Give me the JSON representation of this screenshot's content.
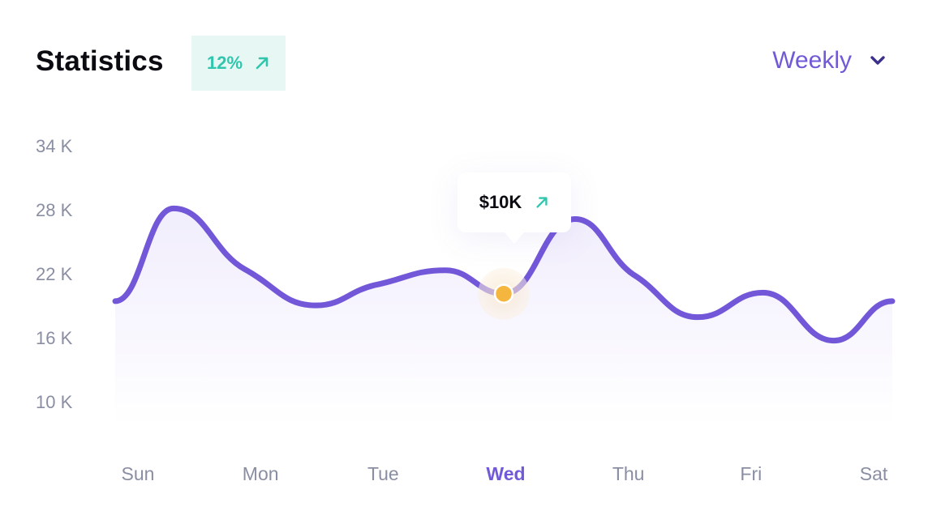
{
  "header": {
    "title": "Statistics",
    "change_badge": {
      "value": "12%",
      "icon": "arrow-up-right-icon",
      "color": "#2fc6ad"
    },
    "period_select": {
      "selected": "Weekly",
      "icon": "chevron-down-icon"
    }
  },
  "tooltip": {
    "value": "$10K",
    "icon": "arrow-up-right-icon",
    "day": "Wed"
  },
  "colors": {
    "line": "#7357d9",
    "accent": "#7259d8",
    "positive": "#2fc6ad",
    "highlight_point": "#f5b63f",
    "axis_text": "#8a8ea3"
  },
  "chart_data": {
    "type": "area",
    "title": "Statistics",
    "xlabel": "",
    "ylabel": "",
    "categories": [
      "Sun",
      "Mon",
      "Tue",
      "Wed",
      "Thu",
      "Fri",
      "Sat"
    ],
    "highlighted_category": "Wed",
    "y_ticks": [
      "34 K",
      "28 K",
      "22 K",
      "16 K",
      "10 K"
    ],
    "ylim": [
      10,
      34
    ],
    "y_unit": "K",
    "grid": false,
    "legend": "none",
    "series": [
      {
        "name": "Statistics",
        "x": [
          0.0,
          0.45,
          1.0,
          1.55,
          2.0,
          2.55,
          3.0,
          3.55,
          4.0,
          4.5,
          5.0,
          5.55,
          6.0
        ],
        "values": [
          19.5,
          28.2,
          22.5,
          19.1,
          21.0,
          22.4,
          20.2,
          27.2,
          22.0,
          18.0,
          20.3,
          15.8,
          19.5
        ]
      }
    ],
    "highlight_point": {
      "x": 3.0,
      "y": 20.2,
      "label": "$10K"
    }
  }
}
